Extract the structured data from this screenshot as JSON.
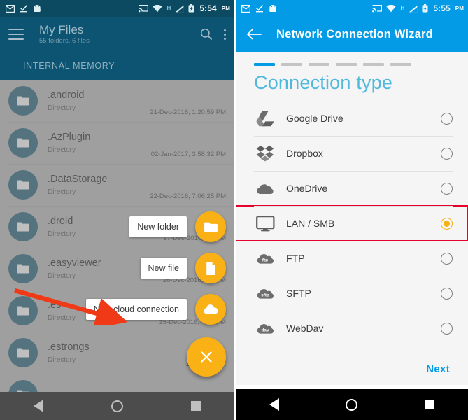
{
  "left_screen": {
    "status_bar": {
      "time": "5:54",
      "ampm": "PM",
      "icons": [
        "gmail-icon",
        "checkmark-download-icon",
        "android-robot-icon",
        "cast-icon",
        "wifi-icon",
        "hspa-icon",
        "signal-icon",
        "battery-icon"
      ]
    },
    "appbar": {
      "title": "My Files",
      "subtitle": "55 folders, 6 files",
      "menu_icon": "hamburger-icon",
      "search_icon": "search-icon",
      "overflow_icon": "more-vertical-icon"
    },
    "section_header": "INTERNAL MEMORY",
    "files": [
      {
        "name": ".android",
        "type": "Directory",
        "date": "21-Dec-2016, 1:20:59 PM"
      },
      {
        "name": ".AzPlugin",
        "type": "Directory",
        "date": "02-Jan-2017, 3:58:32 PM"
      },
      {
        "name": ".DataStorage",
        "type": "Directory",
        "date": "22-Dec-2016, 7:06:25 PM"
      },
      {
        "name": ".droid",
        "type": "Directory",
        "date": "17-Dec-2016, 2:2      AM"
      },
      {
        "name": ".easyviewer",
        "type": "Directory",
        "date": "28-Dec-2016, 4:1    PM"
      },
      {
        "name": ".es",
        "type": "Directory",
        "date": "15-Dec-2016, 4:0  :  PM"
      },
      {
        "name": ".estrongs",
        "type": "Directory",
        "date": "14-Dec-2016,"
      }
    ],
    "fab_menu": {
      "items": [
        {
          "label": "New folder",
          "icon": "folder-icon"
        },
        {
          "label": "New file",
          "icon": "file-icon"
        },
        {
          "label": "New cloud connection",
          "icon": "cloud-icon"
        }
      ],
      "main_icon": "close-icon"
    },
    "annotation": {
      "type": "red-arrow",
      "points_to": "New cloud connection",
      "color": "#f03a17"
    },
    "nav_bar": {
      "back": "back-triangle-icon",
      "home": "home-circle-icon",
      "recents": "recents-square-icon"
    }
  },
  "right_screen": {
    "status_bar": {
      "time": "5:55",
      "ampm": "PM",
      "icons": [
        "gmail-icon",
        "checkmark-download-icon",
        "android-robot-icon",
        "cast-icon",
        "wifi-icon",
        "hspa-icon",
        "signal-icon",
        "battery-icon"
      ]
    },
    "appbar": {
      "title": "Network Connection Wizard",
      "back_icon": "arrow-back-icon"
    },
    "stepper": {
      "total_steps": 6,
      "current_step": 1,
      "active_color": "#039be5",
      "inactive_color": "#c4c4c4"
    },
    "heading": "Connection type",
    "options": [
      {
        "label": "Google Drive",
        "icon": "google-drive-icon",
        "selected": false
      },
      {
        "label": "Dropbox",
        "icon": "dropbox-icon",
        "selected": false
      },
      {
        "label": "OneDrive",
        "icon": "onedrive-icon",
        "selected": false
      },
      {
        "label": "LAN / SMB",
        "icon": "monitor-icon",
        "selected": true,
        "highlighted": true
      },
      {
        "label": "FTP",
        "icon": "ftp-cloud-icon",
        "selected": false
      },
      {
        "label": "SFTP",
        "icon": "sftp-cloud-icon",
        "selected": false
      },
      {
        "label": "WebDav",
        "icon": "dav-cloud-icon",
        "selected": false
      }
    ],
    "footer": {
      "next_label": "Next"
    },
    "nav_bar": {
      "back": "back-triangle-icon",
      "home": "home-circle-icon",
      "recents": "recents-square-icon"
    },
    "colors": {
      "accent": "#039be5",
      "selected_radio": "#f9b115",
      "highlight_box": "#e4002b",
      "heading": "#4fb8dd"
    }
  }
}
